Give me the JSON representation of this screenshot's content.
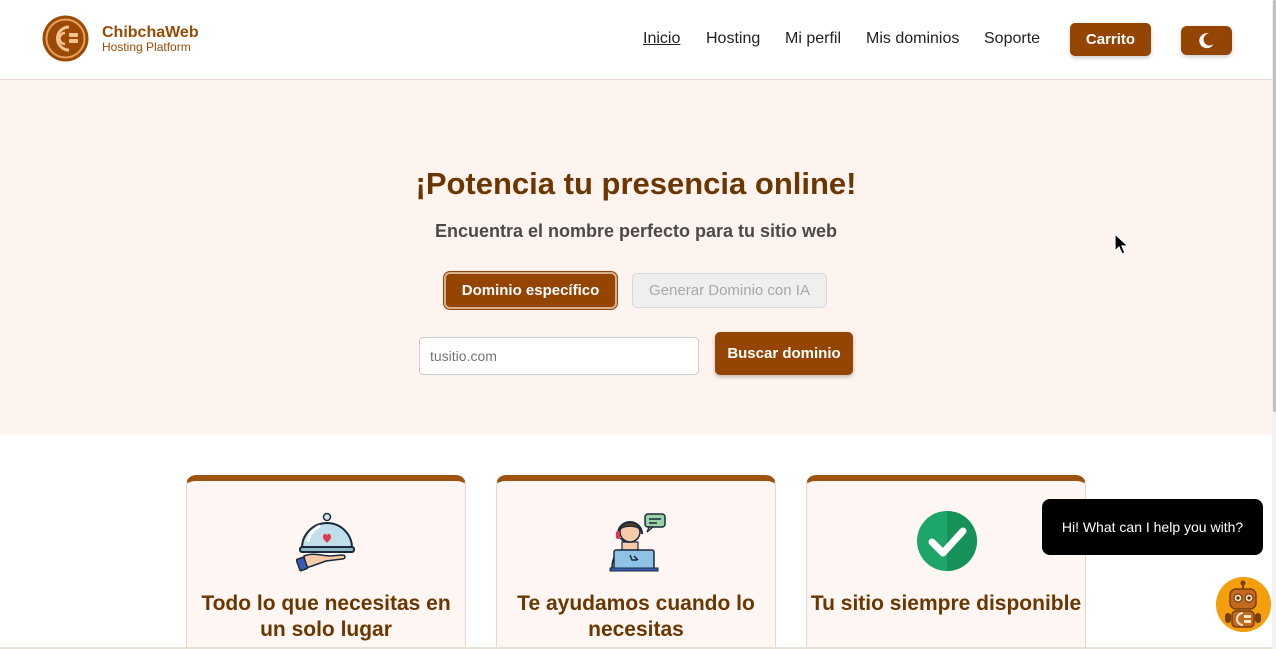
{
  "brand": {
    "name": "ChibchaWeb",
    "subtitle": "Hosting Platform"
  },
  "nav": {
    "items": [
      "Inicio",
      "Hosting",
      "Mi perfil",
      "Mis dominios",
      "Soporte"
    ],
    "active": "Inicio"
  },
  "header": {
    "cart_label": "Carrito",
    "theme_icon": "moon-icon"
  },
  "hero": {
    "title": "¡Potencia tu presencia online!",
    "subtitle": "Encuentra el nombre perfecto para tu sitio web",
    "tabs": [
      {
        "label": "Dominio específico",
        "active": true
      },
      {
        "label": "Generar Dominio con IA",
        "active": false
      }
    ],
    "search": {
      "placeholder": "tusitio.com",
      "value": "",
      "button_label": "Buscar dominio"
    }
  },
  "cards": [
    {
      "title": "Todo lo que necesitas en un solo lugar",
      "icon": "serving-tray-icon"
    },
    {
      "title": "Te ayudamos cuando lo necesitas",
      "icon": "support-agent-icon"
    },
    {
      "title": "Tu sitio siempre disponible",
      "icon": "check-circle-icon"
    }
  ],
  "chat": {
    "message": "Hi! What can I help you with?",
    "bot_icon": "robot-icon"
  },
  "colors": {
    "primary": "#944403",
    "title": "#6b3600",
    "hero_bg": "#fdf4ef",
    "card_border": "#a0520f",
    "check_green": "#1ea56a"
  }
}
